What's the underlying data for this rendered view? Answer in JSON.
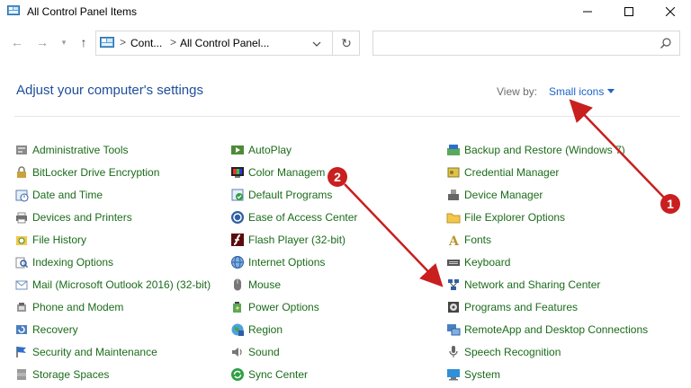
{
  "window": {
    "title": "All Control Panel Items",
    "minimize_glyph": "—",
    "maximize_glyph": "☐",
    "close_glyph": "✕"
  },
  "nav": {
    "back_glyph": "←",
    "forward_glyph": "→",
    "dropdown_glyph": "▾",
    "up_glyph": "↑",
    "breadcrumb_sep": ">",
    "breadcrumbs": [
      "Cont...",
      "All Control Panel..."
    ],
    "refresh_glyph": "↻"
  },
  "search": {
    "value": "",
    "placeholder": ""
  },
  "header": {
    "title": "Adjust your computer's settings",
    "view_by_label": "View by:",
    "view_mode": "Small icons"
  },
  "columns": [
    [
      {
        "label": "Administrative Tools",
        "icon": "admin-tools-icon"
      },
      {
        "label": "BitLocker Drive Encryption",
        "icon": "bitlocker-icon"
      },
      {
        "label": "Date and Time",
        "icon": "date-time-icon"
      },
      {
        "label": "Devices and Printers",
        "icon": "devices-printers-icon"
      },
      {
        "label": "File History",
        "icon": "file-history-icon"
      },
      {
        "label": "Indexing Options",
        "icon": "indexing-icon"
      },
      {
        "label": "Mail (Microsoft Outlook 2016) (32-bit)",
        "icon": "mail-icon"
      },
      {
        "label": "Phone and Modem",
        "icon": "phone-modem-icon"
      },
      {
        "label": "Recovery",
        "icon": "recovery-icon"
      },
      {
        "label": "Security and Maintenance",
        "icon": "security-flag-icon"
      },
      {
        "label": "Storage Spaces",
        "icon": "storage-icon"
      }
    ],
    [
      {
        "label": "AutoPlay",
        "icon": "autoplay-icon"
      },
      {
        "label": "Color Managem",
        "icon": "color-management-icon"
      },
      {
        "label": "Default Programs",
        "icon": "default-programs-icon"
      },
      {
        "label": "Ease of Access Center",
        "icon": "ease-access-icon"
      },
      {
        "label": "Flash Player (32-bit)",
        "icon": "flash-icon"
      },
      {
        "label": "Internet Options",
        "icon": "internet-icon"
      },
      {
        "label": "Mouse",
        "icon": "mouse-icon"
      },
      {
        "label": "Power Options",
        "icon": "power-icon"
      },
      {
        "label": "Region",
        "icon": "region-icon"
      },
      {
        "label": "Sound",
        "icon": "sound-icon"
      },
      {
        "label": "Sync Center",
        "icon": "sync-icon"
      }
    ],
    [
      {
        "label": "Backup and Restore (Windows 7)",
        "icon": "backup-icon"
      },
      {
        "label": "Credential Manager",
        "icon": "credential-icon"
      },
      {
        "label": "Device Manager",
        "icon": "device-manager-icon"
      },
      {
        "label": "File Explorer Options",
        "icon": "folder-options-icon"
      },
      {
        "label": "Fonts",
        "icon": "fonts-icon"
      },
      {
        "label": "Keyboard",
        "icon": "keyboard-icon"
      },
      {
        "label": "Network and Sharing Center",
        "icon": "network-icon"
      },
      {
        "label": "Programs and Features",
        "icon": "programs-icon"
      },
      {
        "label": "RemoteApp and Desktop Connections",
        "icon": "remoteapp-icon"
      },
      {
        "label": "Speech Recognition",
        "icon": "speech-icon"
      },
      {
        "label": "System",
        "icon": "system-icon"
      }
    ]
  ],
  "annotations": [
    {
      "number": "1",
      "color": "#c91f1f"
    },
    {
      "number": "2",
      "color": "#c91f1f"
    }
  ],
  "colors": {
    "heading": "#1e4e9a",
    "item_text": "#1b6b1b",
    "link": "#1c64c8",
    "annotation": "#c91f1f"
  }
}
